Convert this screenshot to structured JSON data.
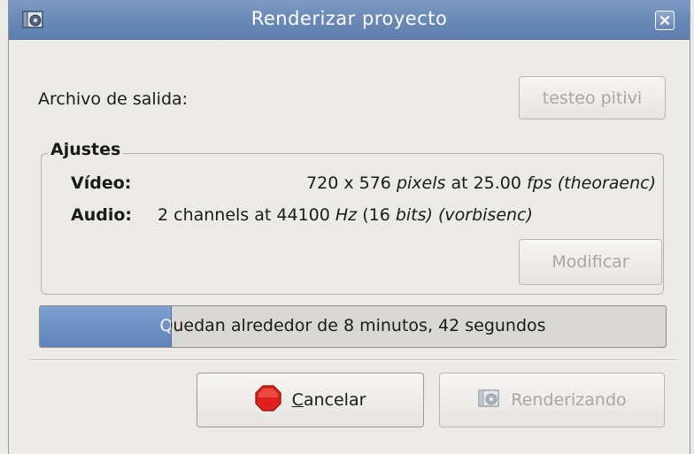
{
  "window": {
    "title": "Renderizar proyecto",
    "app_icon": "render-icon",
    "close_icon": "close-icon"
  },
  "output": {
    "label": "Archivo de salida:",
    "file_button": "testeo pitivi"
  },
  "settings": {
    "frame_title": "Ajustes",
    "video_label": "Vídeo:",
    "video_value": {
      "width_height": "720 x 576",
      "unit": "pixels",
      "at1": "at 25.00",
      "fps": "fps",
      "codec": "(theoraenc)"
    },
    "audio_label": "Audio:",
    "audio_value": {
      "channels": "2 channels at 44100",
      "hz": "Hz",
      "bits_open": "(16",
      "bits": "bits)",
      "codec": "(vorbisenc)"
    },
    "modify_button": "Modificar"
  },
  "progress": {
    "text": "Quedan alrededor de 8 minutos, 42 segundos",
    "fraction": 0.21
  },
  "buttons": {
    "cancel_label_mnemonic": "C",
    "cancel_label_rest": "ancelar",
    "cancel_icon": "stop-icon",
    "render_label": "Renderizando",
    "render_icon": "render-icon"
  },
  "colors": {
    "titlebar": "#6a89b7",
    "progress_fill": "#6a8fc6",
    "stop_red": "#e0201a"
  }
}
